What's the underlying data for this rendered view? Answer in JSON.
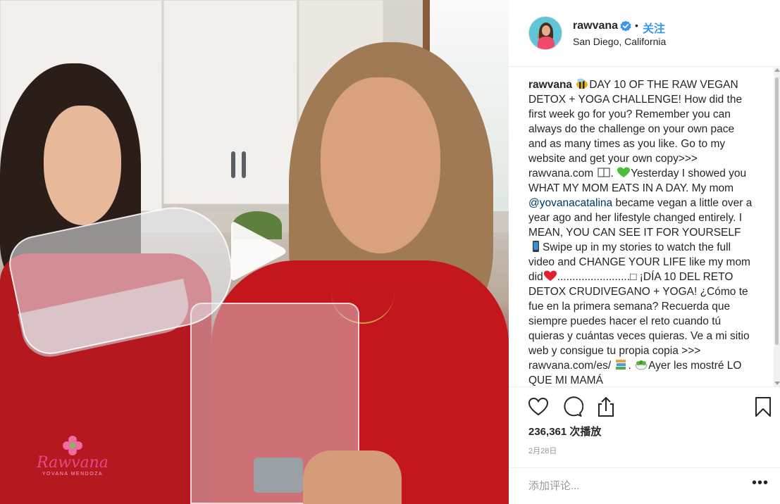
{
  "post": {
    "username": "rawvana",
    "follow_label": "关注",
    "separator": "•",
    "location": "San Diego, California"
  },
  "video": {
    "logo_name": "Rawvana",
    "logo_sub": "YOVANA MENDOZA"
  },
  "caption": {
    "user": "rawvana",
    "p1": "DAY 10 OF THE RAW VEGAN DETOX + YOGA CHALLENGE! How did the first week go for you? Remember you can always do the challenge on your own pace and as many times as you like. Go to my website and get your own copy>>> rawvana.com",
    "p2": ".",
    "p3": "Yesterday I showed you WHAT MY MOM EATS IN A DAY. My mom",
    "mention": "@yovanacatalina",
    "p4": "became vegan a little over a year ago and her lifestyle changed entirely. I MEAN, YOU CAN SEE IT FOR YOURSELF",
    "p5": "Swipe up in my stories to watch the full video and CHANGE YOUR LIFE like my mom did",
    "p6": "........................□",
    "p7": "¡DÍA 10 DEL RETO DETOX CRUDIVEGANO + YOGA! ¿Cómo te fue en la primera semana? Recuerda que siempre puedes hacer el reto cuando tú quieras y cuántas veces quieras. Ve a mi sitio web y consigue tu propia copia >>> rawvana.com/es/",
    "p8": ".",
    "p9": "Ayer les mostré LO QUE MI MAMÁ"
  },
  "stats": {
    "views": "236,361 次播放",
    "date": "2月28日"
  },
  "comment": {
    "placeholder": "添加评论...",
    "more_label": "•••"
  },
  "icons": [
    "verified-icon",
    "play-icon",
    "heart-icon",
    "comment-icon",
    "share-icon",
    "bookmark-icon",
    "more-icon"
  ],
  "colors": {
    "link": "#3897f0",
    "mention": "#003569",
    "accent_logo": "#e34a86"
  }
}
